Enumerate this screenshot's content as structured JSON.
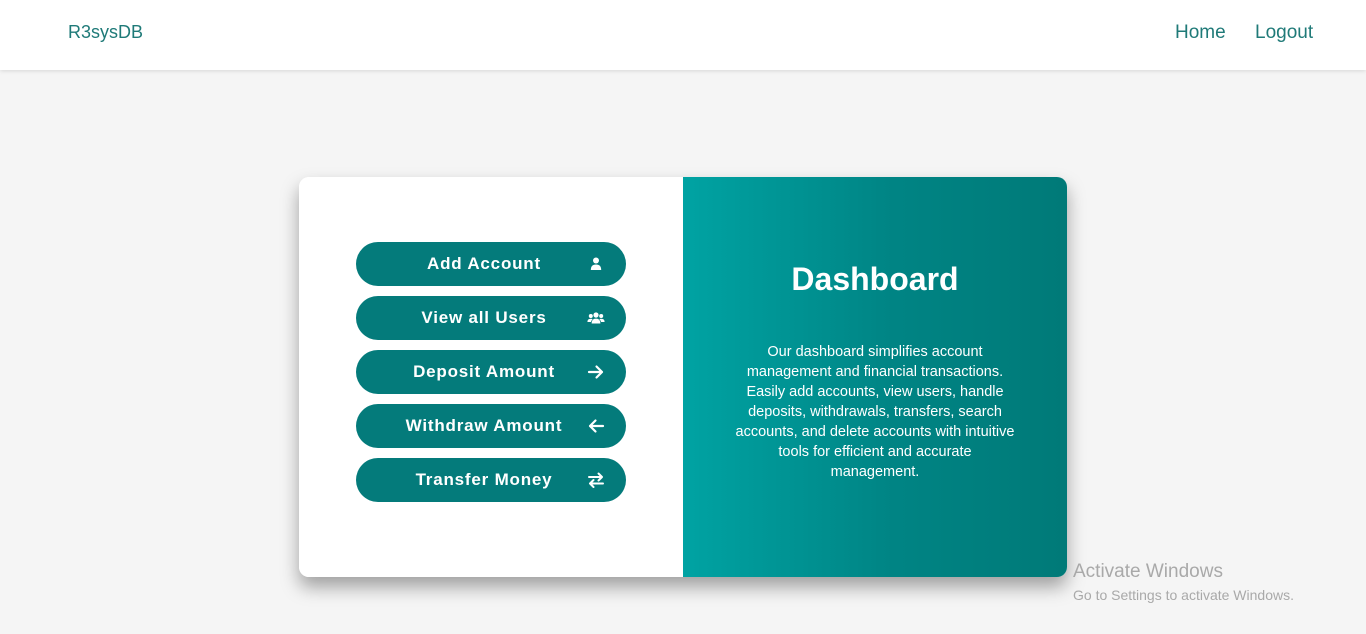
{
  "navbar": {
    "brand": "R3sysDB",
    "links": {
      "home": "Home",
      "logout": "Logout"
    },
    "text_color": "#1f7a78"
  },
  "actions": [
    {
      "label": "Add Account",
      "icon": "user-icon"
    },
    {
      "label": "View all Users",
      "icon": "users-icon"
    },
    {
      "label": "Deposit Amount",
      "icon": "arrow-right-icon"
    },
    {
      "label": "Withdraw Amount",
      "icon": "arrow-left-icon"
    },
    {
      "label": "Transfer Money",
      "icon": "exchange-icon"
    }
  ],
  "dashboard": {
    "title": "Dashboard",
    "description": "Our dashboard simplifies account management and financial transactions. Easily add accounts, view users, handle deposits, withdrawals, transfers, search accounts, and delete accounts with intuitive tools for efficient and accurate management."
  },
  "colors": {
    "button_bg": "#047b7b",
    "panel_gradient_start": "#00a3a3",
    "panel_gradient_end": "#007a78",
    "page_bg": "#f5f5f5"
  },
  "os_watermark": {
    "title": "Activate Windows",
    "subtitle": "Go to Settings to activate Windows."
  }
}
